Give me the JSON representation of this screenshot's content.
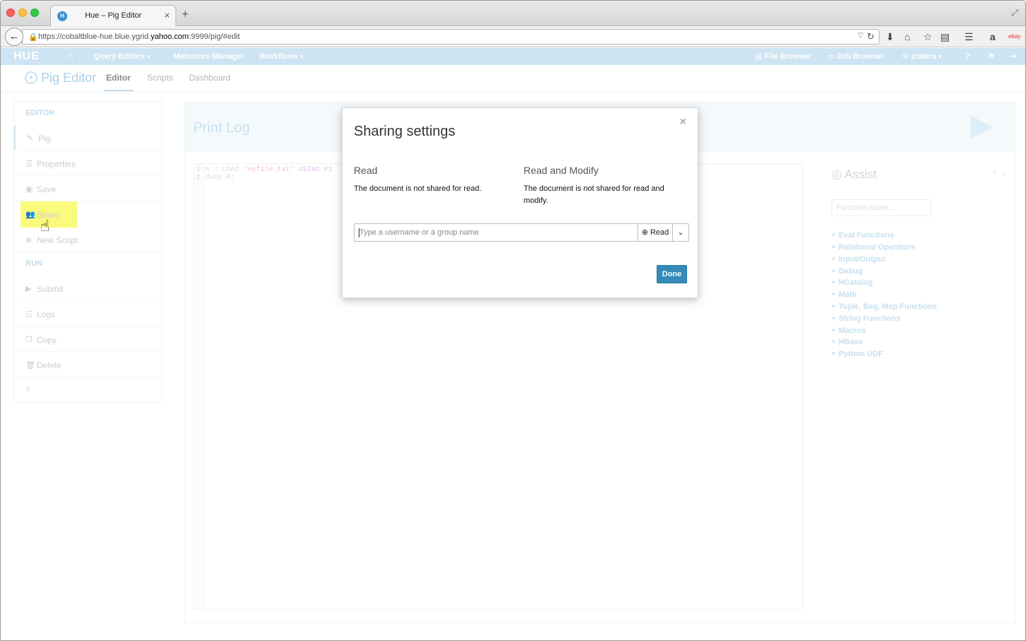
{
  "browser": {
    "tab_title": "Hue – Pig Editor",
    "new_tab": "+",
    "url_prefix": "https://cobaltblue-hue.blue.ygrid.",
    "url_host": "yahoo.com",
    "url_suffix": ":9999/pig/#edit"
  },
  "hue_nav": {
    "logo": "HUE",
    "items": [
      "Query Editors",
      "Metastore Manager",
      "Workflows"
    ],
    "right_items": [
      "File Browser",
      "Job Browser",
      "jcatera"
    ]
  },
  "app": {
    "title": "Pig Editor",
    "tabs": [
      "Editor",
      "Scripts",
      "Dashboard"
    ]
  },
  "sidebar": {
    "editor_header": "EDITOR",
    "run_header": "RUN",
    "editor_items": [
      "Pig",
      "Properties",
      "Save",
      "Share",
      "New Script"
    ],
    "run_items": [
      "Submit",
      "Logs",
      "Copy",
      "Delete"
    ]
  },
  "main": {
    "title": "Print Log",
    "code": {
      "line1_a": "A = LOAD ",
      "line1_str": "'myfile.txt'",
      "line1_kw": " USING Pi",
      "line2": "dump A;"
    },
    "line_numbers": [
      "1",
      "2"
    ]
  },
  "assist": {
    "title": "Assist",
    "search_placeholder": "Function name...",
    "links": [
      "Eval Functions",
      "Relational Operators",
      "Input/Output",
      "Debug",
      "HCatalog",
      "Math",
      "Tuple, Bag, Map Functions",
      "String Functions",
      "Macros",
      "HBase",
      "Python UDF"
    ]
  },
  "modal": {
    "title": "Sharing settings",
    "close": "×",
    "read_title": "Read",
    "read_text": "The document is not shared for read.",
    "modify_title": "Read and Modify",
    "modify_text": "The document is not shared for read and modify.",
    "input_placeholder": "Type a username or a group name",
    "permission_label": "Read",
    "done_label": "Done"
  },
  "colors": {
    "hue_nav_bg": "#cde4f2",
    "done_button": "#338bb8",
    "highlight": "#fafa7c"
  }
}
